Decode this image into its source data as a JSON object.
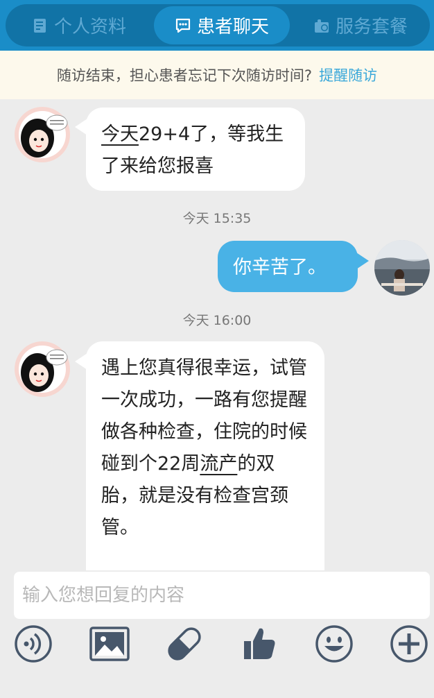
{
  "tabs": [
    {
      "label": "个人资料",
      "icon": "profile-doc-icon"
    },
    {
      "label": "患者聊天",
      "icon": "chat-bubble-icon",
      "active": true
    },
    {
      "label": "服务套餐",
      "icon": "gift-package-icon"
    }
  ],
  "notice": {
    "text": "随访结束，担心患者忘记下次随访时间?",
    "link": "提醒随访"
  },
  "messages": [
    {
      "side": "left",
      "parts": [
        {
          "text": "今天",
          "underline": true
        },
        {
          "text": "29+4了，等我生了来给您报喜"
        }
      ]
    },
    {
      "type": "timestamp",
      "text": "今天 15:35"
    },
    {
      "side": "right",
      "parts": [
        {
          "text": "你辛苦了。"
        }
      ]
    },
    {
      "type": "timestamp",
      "text": "今天 16:00"
    },
    {
      "side": "left",
      "parts": [
        {
          "text": "遇上您真得很幸运，试管一次成功，一路有您提醒做各种检查，住院的时候碰到个22周"
        },
        {
          "text": "流产",
          "underline": true
        },
        {
          "text": "的双胎，就是没有检查宫颈管。"
        }
      ]
    }
  ],
  "input": {
    "placeholder": "输入您想回复的内容",
    "value": ""
  },
  "toolbar": [
    "voice-icon",
    "image-icon",
    "pill-icon",
    "thumbs-up-icon",
    "smiley-icon",
    "add-icon"
  ],
  "colors": {
    "primary": "#1a8dc8",
    "bubble_right": "#49b2e6",
    "link": "#3aa8da"
  }
}
